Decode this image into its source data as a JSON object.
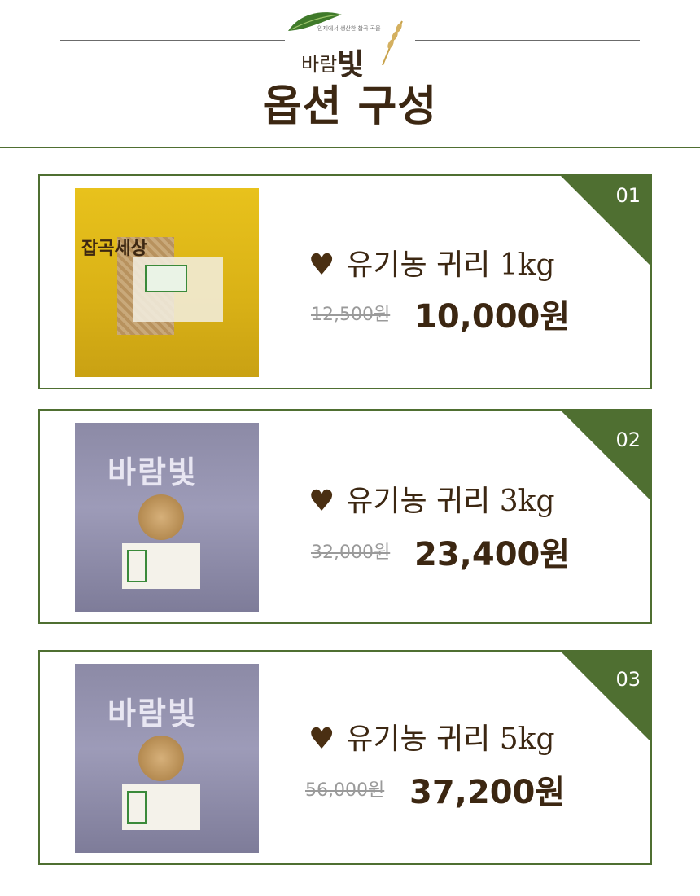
{
  "header": {
    "logo_tagline": "인제에서 생산한 찹곡 곡물",
    "logo_text": "바람",
    "logo_big": "빛",
    "title": "옵션 구성"
  },
  "options": [
    {
      "number": "01",
      "name": "유기농 귀리 1kg",
      "original_price": "12,500원",
      "price": "10,000원",
      "bag_label": "잡곡세상"
    },
    {
      "number": "02",
      "name": "유기농 귀리 3kg",
      "original_price": "32,000원",
      "price": "23,400원",
      "bag_label": "바람빛"
    },
    {
      "number": "03",
      "name": "유기농 귀리 5kg",
      "original_price": "56,000원",
      "price": "37,200원",
      "bag_label": "바람빛"
    }
  ],
  "icons": {
    "bullet": "heart-icon"
  },
  "colors": {
    "accent_green": "#4f6f31",
    "text_brown": "#3c2712"
  }
}
